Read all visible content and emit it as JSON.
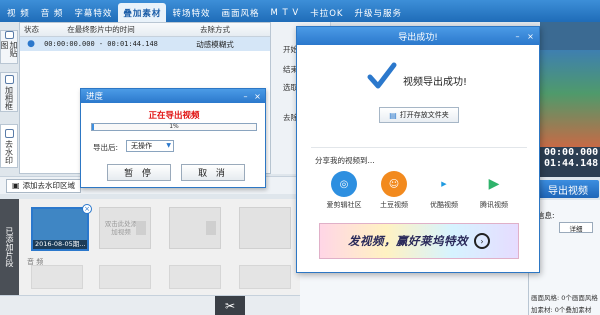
{
  "tabs": [
    "视  频",
    "音  频",
    "字幕特效",
    "叠加素材",
    "转场特效",
    "画面风格",
    "M T V",
    "卡拉OK",
    "升级与服务"
  ],
  "active_tab_index": 3,
  "side_tabs": {
    "add_sticker": "加贴图",
    "add_frame": "加相框",
    "remove_watermark": "去水印"
  },
  "list": {
    "col_status": "状态",
    "col_time": "在最终影片中的时间",
    "col_type": "去除方式",
    "row_time": "00:00:00.000 - 00:01:44.148",
    "row_type": "动感模糊式"
  },
  "mid_labels": [
    "开始",
    "结束",
    "选取",
    "去除"
  ],
  "preview": {
    "time1": "00:00.000",
    "time2": "01:44.148"
  },
  "export_button": "导出视频",
  "info": {
    "title": "信息:",
    "detail_button": "详细",
    "style_label": "画面风格:",
    "style_value": "0个画面风格",
    "added_label": "加素材:",
    "added_value": "0个叠加素材"
  },
  "add_region_button": "添加去水印区域",
  "added_clips": "已添加片段",
  "clip_date": "2016-08-05",
  "clip_suffix": "期...",
  "slot_hint": "双击此处添加视频",
  "audio_label": "音  频",
  "progress": {
    "title": "进度",
    "status": "正在导出视频",
    "percent": 0.01,
    "percent_label": "1%",
    "after_label": "导出后:",
    "after_value": "无操作",
    "pause": "暂 停",
    "cancel": "取 消"
  },
  "success": {
    "title": "导出成功!",
    "message": "视频导出成功!",
    "open_folder": "打开存放文件夹",
    "share_label": "分享我的视频到...",
    "share": [
      "爱剪辑社区",
      "土豆视频",
      "优酷视频",
      "腾讯视频"
    ],
    "banner": "发视频，赢好莱坞特效"
  },
  "colors": {
    "accent": "#2b78cc",
    "status_red": "#e01010"
  }
}
